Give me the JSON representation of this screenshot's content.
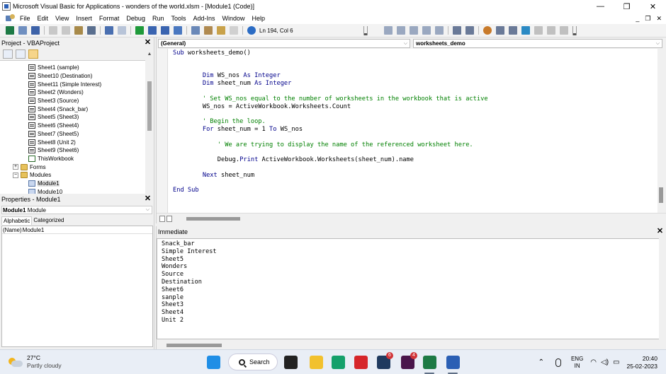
{
  "window": {
    "title": "Microsoft Visual Basic for Applications - wonders of the world.xlsm - [Module1 (Code)]",
    "minimize": "—",
    "restore": "❐",
    "close": "✕"
  },
  "menubar": {
    "items": [
      "File",
      "Edit",
      "View",
      "Insert",
      "Format",
      "Debug",
      "Run",
      "Tools",
      "Add-Ins",
      "Window",
      "Help"
    ],
    "mdi_minimize": "_",
    "mdi_restore": "❐",
    "mdi_close": "✕"
  },
  "toolbar": {
    "cursor_position": "Ln 194, Col 6"
  },
  "project": {
    "title": "Project - VBAProject",
    "tree": [
      {
        "label": "Sheet1 (sample)",
        "icon": "sheet-icon",
        "indent": 2
      },
      {
        "label": "Sheet10 (Destination)",
        "icon": "sheet-icon",
        "indent": 2
      },
      {
        "label": "Sheet11 (Simple Interest)",
        "icon": "sheet-icon",
        "indent": 2
      },
      {
        "label": "Sheet2 (Wonders)",
        "icon": "sheet-icon",
        "indent": 2
      },
      {
        "label": "Sheet3 (Source)",
        "icon": "sheet-icon",
        "indent": 2
      },
      {
        "label": "Sheet4 (Snack_bar)",
        "icon": "sheet-icon",
        "indent": 2
      },
      {
        "label": "Sheet5 (Sheet3)",
        "icon": "sheet-icon",
        "indent": 2
      },
      {
        "label": "Sheet6 (Sheet4)",
        "icon": "sheet-icon",
        "indent": 2
      },
      {
        "label": "Sheet7 (Sheet5)",
        "icon": "sheet-icon",
        "indent": 2
      },
      {
        "label": "Sheet8 (Unit 2)",
        "icon": "sheet-icon",
        "indent": 2
      },
      {
        "label": "Sheet9 (Sheet6)",
        "icon": "sheet-icon",
        "indent": 2
      },
      {
        "label": "ThisWorkbook",
        "icon": "workbook-icon",
        "indent": 2
      },
      {
        "label": "Forms",
        "icon": "folder-icon",
        "indent": 1,
        "expander": "+"
      },
      {
        "label": "Modules",
        "icon": "folder-icon",
        "indent": 1,
        "expander": "−"
      },
      {
        "label": "Module1",
        "icon": "module-icon",
        "indent": 2,
        "selected": true
      },
      {
        "label": "Module10",
        "icon": "module-icon",
        "indent": 2
      }
    ]
  },
  "properties": {
    "title": "Properties - Module1",
    "object_name": "Module1",
    "object_type": "Module",
    "tabs": [
      "Alphabetic",
      "Categorized"
    ],
    "rows": [
      {
        "name": "(Name)",
        "value": "Module1"
      }
    ]
  },
  "code": {
    "object_combo": "(General)",
    "procedure_combo": "worksheets_demo",
    "lines": [
      [
        {
          "t": "Sub",
          "c": "kw"
        },
        {
          "t": " worksheets_demo()",
          "c": ""
        }
      ],
      [],
      [],
      [
        {
          "t": "        ",
          "c": ""
        },
        {
          "t": "Dim",
          "c": "kw"
        },
        {
          "t": " WS_nos ",
          "c": ""
        },
        {
          "t": "As Integer",
          "c": "kw"
        }
      ],
      [
        {
          "t": "        ",
          "c": ""
        },
        {
          "t": "Dim",
          "c": "kw"
        },
        {
          "t": " sheet_num ",
          "c": ""
        },
        {
          "t": "As Integer",
          "c": "kw"
        }
      ],
      [],
      [
        {
          "t": "        ' Set WS_nos equal to the number of worksheets in the workbook that is active",
          "c": "cm"
        }
      ],
      [
        {
          "t": "        WS_nos = ActiveWorkbook.Worksheets.Count",
          "c": ""
        }
      ],
      [],
      [
        {
          "t": "        ' Begin the loop.",
          "c": "cm"
        }
      ],
      [
        {
          "t": "        ",
          "c": ""
        },
        {
          "t": "For",
          "c": "kw"
        },
        {
          "t": " sheet_num = 1 ",
          "c": ""
        },
        {
          "t": "To",
          "c": "kw"
        },
        {
          "t": " WS_nos",
          "c": ""
        }
      ],
      [],
      [
        {
          "t": "            ' We are trying to display the name of the referenced worksheet here.",
          "c": "cm"
        }
      ],
      [],
      [
        {
          "t": "            Debug.",
          "c": ""
        },
        {
          "t": "Print",
          "c": "kw"
        },
        {
          "t": " ActiveWorkbook.Worksheets(sheet_num).name",
          "c": ""
        }
      ],
      [],
      [
        {
          "t": "        ",
          "c": ""
        },
        {
          "t": "Next",
          "c": "kw"
        },
        {
          "t": " sheet_num",
          "c": ""
        }
      ],
      [],
      [
        {
          "t": "End Sub",
          "c": "kw"
        }
      ]
    ]
  },
  "immediate": {
    "title": "Immediate",
    "output": [
      "Snack_bar",
      "Simple Interest",
      "Sheet5",
      "Wonders",
      "Source",
      "Destination",
      "Sheet6",
      "sanple",
      "Sheet3",
      "Sheet4",
      "Unit 2"
    ]
  },
  "taskbar": {
    "weather_temp": "27°C",
    "weather_condition": "Partly cloudy",
    "search_label": "Search",
    "apps": [
      {
        "name": "windows-start-icon",
        "color": "#1f8ee6"
      },
      {
        "name": "task-view-icon",
        "color": "#222222"
      },
      {
        "name": "file-explorer-icon",
        "color": "#f2c12e"
      },
      {
        "name": "edge-icon",
        "color": "#14a06b"
      },
      {
        "name": "acrobat-icon",
        "color": "#d6262b"
      },
      {
        "name": "whatsapp-icon",
        "color": "#1f3a5f",
        "badge": "6"
      },
      {
        "name": "slack-icon",
        "color": "#4a154b",
        "badge": "4"
      },
      {
        "name": "excel-icon",
        "color": "#1d7a45"
      },
      {
        "name": "word-icon",
        "color": "#2b5fb4"
      }
    ],
    "lang_1": "ENG",
    "lang_2": "IN",
    "time": "20:40",
    "date": "25-02-2023"
  }
}
